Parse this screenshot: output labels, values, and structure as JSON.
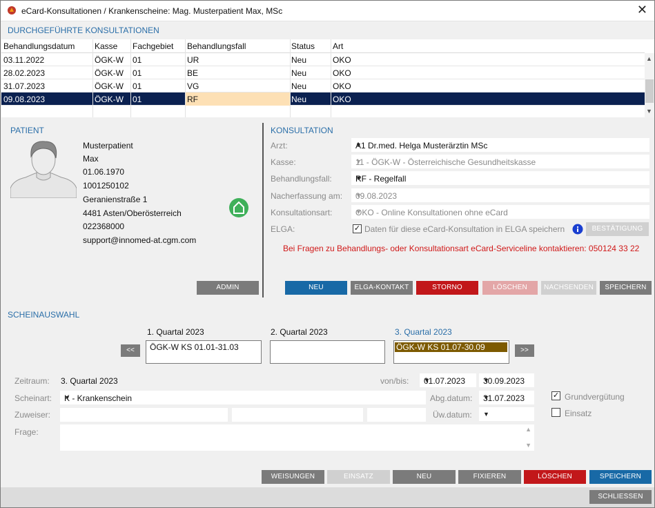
{
  "window": {
    "title": "eCard-Konsultationen / Krankenscheine: Mag. Musterpatient Max, MSc",
    "close": "✕"
  },
  "sections": {
    "konsultationen": "DURCHGEFÜHRTE KONSULTATIONEN",
    "patient": "PATIENT",
    "konsultation": "KONSULTATION",
    "scheinauswahl": "SCHEINAUSWAHL"
  },
  "table": {
    "columns": [
      "Behandlungsdatum",
      "Kasse",
      "Fachgebiet",
      "Behandlungsfall",
      "Status",
      "Art"
    ],
    "rows": [
      [
        "03.11.2022",
        "ÖGK-W",
        "01",
        "UR",
        "Neu",
        "OKO"
      ],
      [
        "28.02.2023",
        "ÖGK-W",
        "01",
        "BE",
        "Neu",
        "OKO"
      ],
      [
        "31.07.2023",
        "ÖGK-W",
        "01",
        "VG",
        "Neu",
        "OKO"
      ],
      [
        "09.08.2023",
        "ÖGK-W",
        "01",
        "RF",
        "Neu",
        "OKO"
      ]
    ]
  },
  "patient": {
    "nachname": "Musterpatient",
    "vorname": "Max",
    "geburtsdatum": "01.06.1970",
    "svnr": "1001250102",
    "strasse": "Geranienstraße 1",
    "ort": "4481 Asten/Oberösterreich",
    "telefon": "022368000",
    "email": "support@innomed-at.cgm.com",
    "admin": "ADMIN"
  },
  "konsultation": {
    "arzt_label": "Arzt:",
    "arzt": "A1   Dr.med. Helga Musterärztin MSc",
    "kasse_label": "Kasse:",
    "kasse": "11 - ÖGK-W - Österreichische Gesundheitskasse",
    "fall_label": "Behandlungsfall:",
    "fall": "RF - Regelfall",
    "nach_label": "Nacherfassung am:",
    "nach": "09.08.2023",
    "art_label": "Konsultationsart:",
    "art": "OKO - Online Konsultationen ohne eCard",
    "elga_label": "ELGA:",
    "elga_check": "Daten für diese eCard-Konsultation in ELGA speichern",
    "bestaetigung": "BESTÄTIGUNG",
    "hinweis": "Bei Fragen zu Behandlungs- oder Konsultationsart eCard-Serviceline kontaktieren: 050124 33 22",
    "buttons": {
      "neu": "NEU",
      "elga": "ELGA-KONTAKT",
      "storno": "STORNO",
      "loeschen": "LÖSCHEN",
      "nachsenden": "NACHSENDEN",
      "speichern": "SPEICHERN"
    }
  },
  "schein": {
    "q1_title": "1. Quartal 2023",
    "q1_item": "ÖGK-W KS 01.01-31.03",
    "q2_title": "2. Quartal 2023",
    "q3_title": "3. Quartal 2023",
    "q3_item": "ÖGK-W KS 01.07-30.09",
    "prev": "<<",
    "next": ">>",
    "zeitraum_label": "Zeitraum:",
    "zeitraum": "3. Quartal 2023",
    "vonbis_label": "von/bis:",
    "von": "01.07.2023",
    "bis": "30.09.2023",
    "scheinart_label": "Scheinart:",
    "scheinart": "K - Krankenschein",
    "abg_label": "Abg.datum:",
    "abg": "31.07.2023",
    "zuweiser_label": "Zuweiser:",
    "uew_label": "Üw.datum:",
    "frage_label": "Frage:",
    "grund": "Grundvergütung",
    "einsatz": "Einsatz",
    "buttons": {
      "weisungen": "WEISUNGEN",
      "einsatz": "EINSATZ",
      "neu": "NEU",
      "fixieren": "FIXIEREN",
      "loeschen": "LÖSCHEN",
      "speichern": "SPEICHERN"
    },
    "schliessen": "SCHLIESSEN"
  },
  "colors": {
    "accent": "#2a6ea8",
    "selected_row": "#0b2150",
    "highlight_cell": "#fde0b5",
    "blue_button": "#1869a6",
    "red_button": "#c2171a",
    "home_icon": "#3fb05a",
    "warning_text": "#d01818"
  }
}
